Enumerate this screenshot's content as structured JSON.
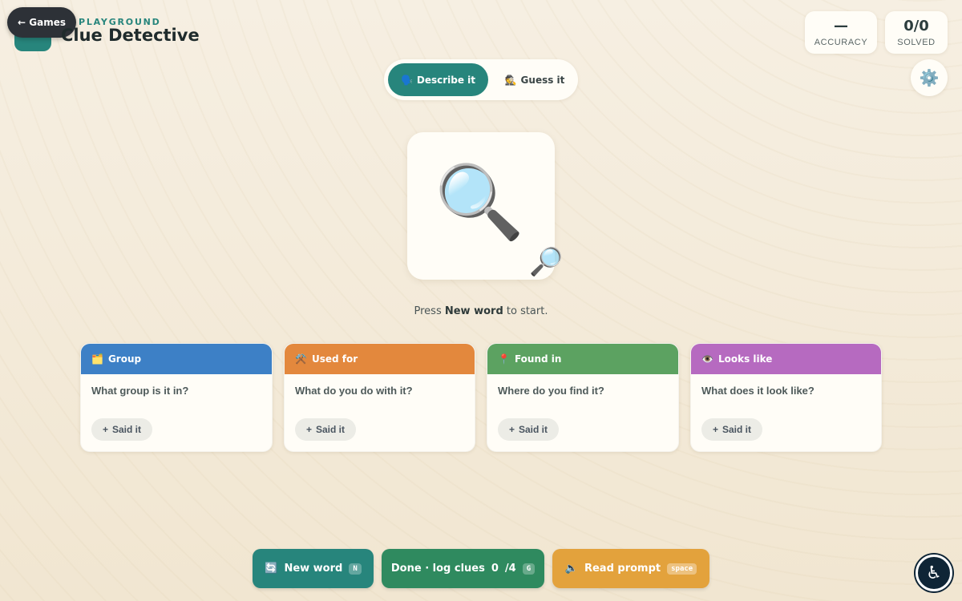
{
  "header": {
    "games_label": "← Games",
    "eyebrow": "PLAYGROUND",
    "title": "Clue Detective"
  },
  "stats": {
    "accuracy": {
      "value": "—",
      "label": "ACCURACY"
    },
    "solved": {
      "value": "0/0",
      "label": "SOLVED"
    }
  },
  "settings": {
    "icon": "gear-icon",
    "glyph": "⚙️"
  },
  "modes": {
    "describe": {
      "icon": "🗣️",
      "label": "Describe it",
      "active": true
    },
    "guess": {
      "icon": "🕵️",
      "label": "Guess it",
      "active": false
    }
  },
  "picture": {
    "glyph": "🔍",
    "badge_glyph": "🔎"
  },
  "prompt": {
    "before": "Press ",
    "bold": "New word",
    "after": " to start."
  },
  "clues": [
    {
      "icon": "🗂️",
      "title": "Group",
      "question": "What group is it in?",
      "button": "Said it",
      "color": "#3d80c6"
    },
    {
      "icon": "⚒️",
      "title": "Used for",
      "question": "What do you do with it?",
      "button": "Said it",
      "color": "#e3883d"
    },
    {
      "icon": "📍",
      "title": "Found in",
      "question": "Where do you find it?",
      "button": "Said it",
      "color": "#5ca261"
    },
    {
      "icon": "👁️",
      "title": "Looks like",
      "question": "What does it look like?",
      "button": "Said it",
      "color": "#b66ac0"
    }
  ],
  "actions": {
    "new_word": {
      "icon": "🔄",
      "label": "New word",
      "key": "N"
    },
    "done": {
      "label": "Done · log clues",
      "count": "0",
      "total": "/4",
      "key": "G"
    },
    "read": {
      "icon": "🔈",
      "label": "Read prompt",
      "key": "space"
    }
  },
  "accessibility": {
    "glyph": "♿"
  }
}
